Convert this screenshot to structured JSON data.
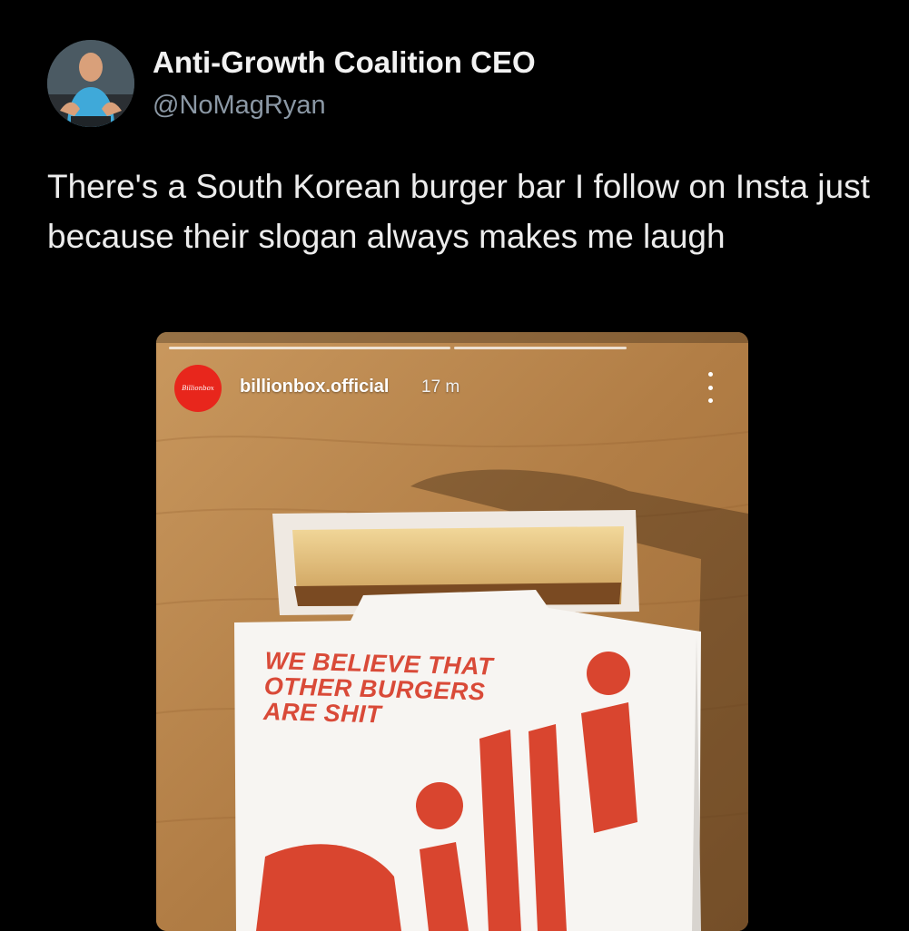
{
  "author": {
    "display_name": "Anti-Growth Coalition CEO",
    "handle": "@NoMagRyan"
  },
  "tweet": {
    "text": "There's a South Korean burger bar I follow on Insta just because their slogan always makes me laugh"
  },
  "story": {
    "account_name": "billionbox.official",
    "time_ago": "17 m",
    "avatar_text": "Billionbox",
    "box_slogan": "WE BELIEVE THAT OTHER BURGERS ARE SHIT",
    "icons": {
      "menu": "more-vertical-icon"
    },
    "colors": {
      "brand_red": "#e8261c",
      "slogan_red": "#d94a38"
    }
  }
}
